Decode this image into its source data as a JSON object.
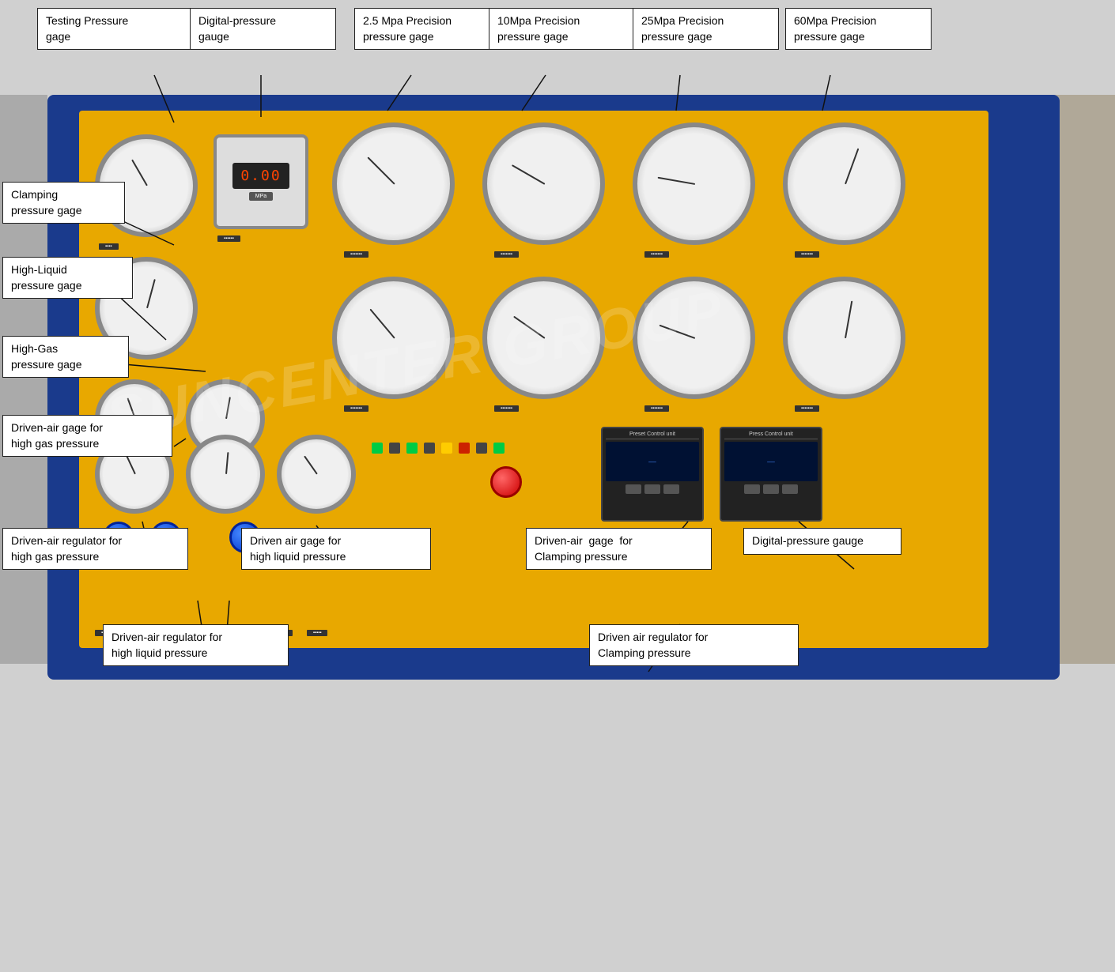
{
  "annotations": {
    "testing_pressure_gage": "Testing Pressure\ngage",
    "digital_pressure_gauge_top": "Digital-pressure\ngauge",
    "precision_2_5_mpa": "2.5 Mpa Precision\npressure gage",
    "precision_10_mpa": "10Mpa Precision\npressure gage",
    "precision_25_mpa": "25Mpa Precision\npressure gage",
    "precision_60_mpa": "60Mpa Precision\npressure gage",
    "clamping_pressure_gage": "Clamping\npressure gage",
    "high_liquid_pressure_gage": "High-Liquid\npressure gage",
    "high_gas_pressure_gage": "High-Gas\npressure gage",
    "driven_air_gage_high_gas": "Driven-air gage for\nhigh gas pressure",
    "driven_air_regulator_high_gas": "Driven-air regulator for\nhigh gas pressure",
    "driven_air_regulator_high_liquid": "Driven-air regulator for\nhigh liquid pressure",
    "driven_air_gage_high_liquid": "Driven air gage for\nhigh liquid pressure",
    "driven_air_gage_clamping": "Driven-air  gage  for\nClamping pressure",
    "digital_pressure_gauge_bottom": "Digital-pressure gauge",
    "driven_air_regulator_clamping": "Driven air regulator for\nClamping pressure",
    "watermark": "SUNCENTER GROUP"
  }
}
